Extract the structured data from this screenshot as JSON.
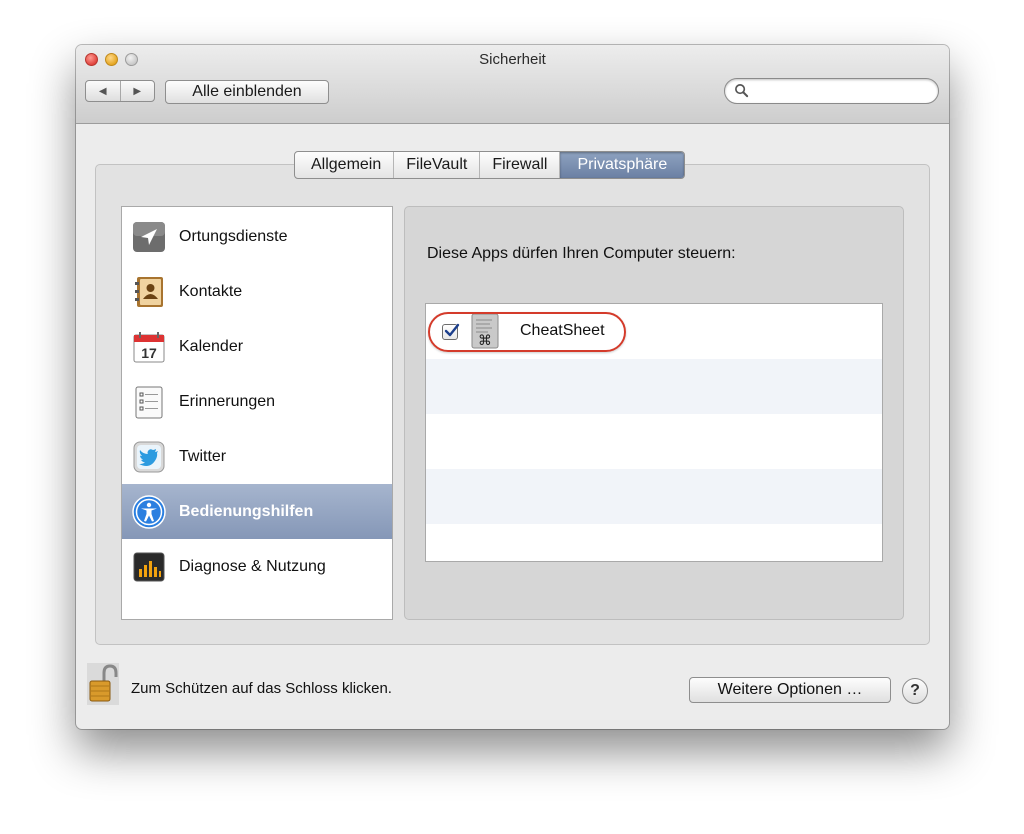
{
  "window": {
    "title": "Sicherheit",
    "nav_back": "◀",
    "nav_forward": "▶",
    "show_all_label": "Alle einblenden",
    "search_placeholder": ""
  },
  "tabs": [
    {
      "label": "Allgemein",
      "active": false
    },
    {
      "label": "FileVault",
      "active": false
    },
    {
      "label": "Firewall",
      "active": false
    },
    {
      "label": "Privatsphäre",
      "active": true
    }
  ],
  "sidebar": {
    "items": [
      {
        "label": "Ortungsdienste",
        "icon": "location-arrow-icon",
        "selected": false
      },
      {
        "label": "Kontakte",
        "icon": "contacts-book-icon",
        "selected": false
      },
      {
        "label": "Kalender",
        "icon": "calendar-icon",
        "selected": false,
        "icon_text": "17"
      },
      {
        "label": "Erinnerungen",
        "icon": "reminders-list-icon",
        "selected": false
      },
      {
        "label": "Twitter",
        "icon": "twitter-bird-icon",
        "selected": false
      },
      {
        "label": "Bedienungshilfen",
        "icon": "accessibility-icon",
        "selected": true
      },
      {
        "label": "Diagnose & Nutzung",
        "icon": "diagnostics-icon",
        "selected": false
      }
    ]
  },
  "detail": {
    "heading": "Diese Apps dürfen Ihren Computer steuern:",
    "apps": [
      {
        "name": "CheatSheet",
        "checked": true,
        "icon": "cheatsheet-app-icon",
        "highlighted": true
      }
    ]
  },
  "footer": {
    "lock_text": "Zum Schützen auf das Schloss klicken.",
    "options_button": "Weitere Optionen …",
    "help_button": "?"
  },
  "colors": {
    "selection": "#8597b7",
    "active_tab": "#6b80a3",
    "highlight_ring": "#d43b2b"
  }
}
